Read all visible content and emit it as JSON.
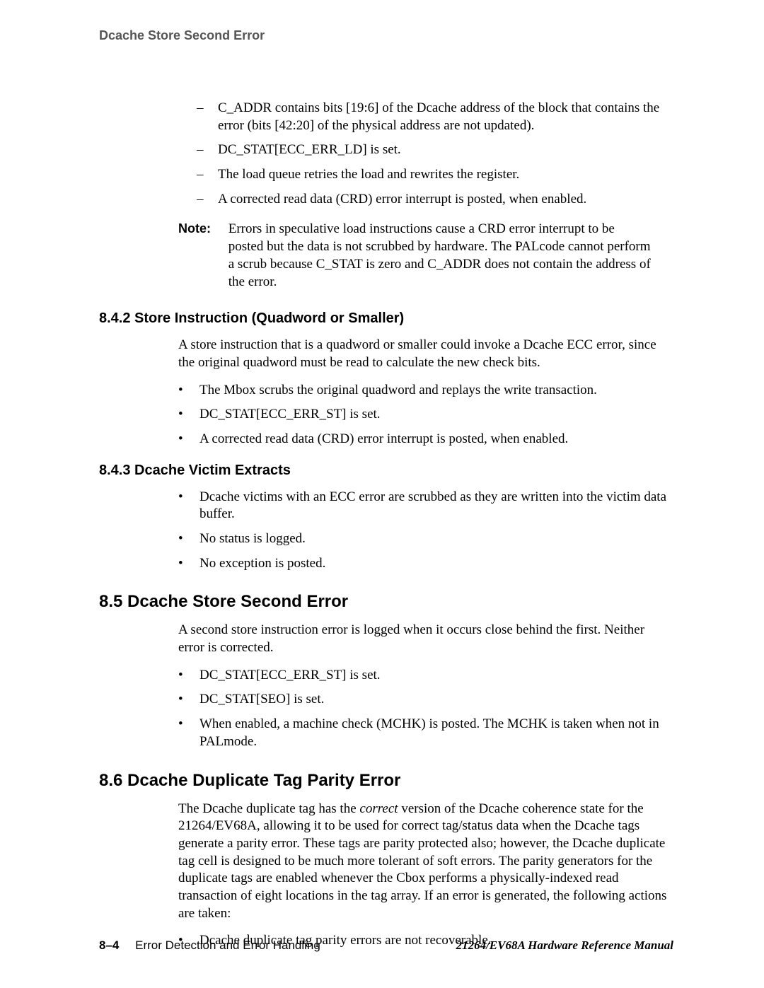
{
  "runningHead": "Dcache Store Second Error",
  "dashList": [
    "C_ADDR contains bits [19:6] of the Dcache address of the block that contains the error  (bits [42:20] of the physical address are not updated).",
    "DC_STAT[ECC_ERR_LD] is set.",
    "The load queue retries the load and rewrites the register.",
    "A corrected read data (CRD) error interrupt is posted, when enabled."
  ],
  "note": {
    "label": "Note:",
    "body": "Errors in speculative load instructions cause a CRD error interrupt to be posted but the data is not scrubbed by hardware. The PALcode cannot perform a scrub because C_STAT is zero and C_ADDR does not contain the address of the error."
  },
  "s842": {
    "heading": "8.4.2  Store Instruction (Quadword or Smaller)",
    "para": "A store instruction that is a quadword or smaller could invoke a Dcache ECC error, since the original quadword must be read to calculate the new check bits.",
    "bullets": [
      "The Mbox scrubs the original quadword and replays the write transaction.",
      "DC_STAT[ECC_ERR_ST] is set.",
      "A corrected read data (CRD) error interrupt is posted, when enabled."
    ]
  },
  "s843": {
    "heading": "8.4.3  Dcache Victim Extracts",
    "bullets": [
      "Dcache victims with an ECC error are scrubbed as they are written into the victim data buffer.",
      "No status is logged.",
      "No exception is posted."
    ]
  },
  "s85": {
    "heading": "8.5  Dcache Store Second Error",
    "para": "A second store instruction error is logged when it occurs close behind the first. Neither error is corrected.",
    "bullets": [
      "DC_STAT[ECC_ERR_ST] is set.",
      "DC_STAT[SEO] is set.",
      "When enabled, a machine check (MCHK) is posted. The MCHK is taken when not in PALmode."
    ]
  },
  "s86": {
    "heading": "8.6  Dcache Duplicate Tag Parity Error",
    "para_before": "The Dcache duplicate tag has the ",
    "para_em": "correct",
    "para_after": " version of the Dcache coherence state for the 21264/EV68A, allowing it to be used for correct tag/status data when the Dcache tags generate a parity error. These tags are parity protected also; however, the Dcache duplicate tag cell is designed to be much more tolerant of soft errors. The parity generators for the duplicate tags are enabled whenever the Cbox performs a physically-indexed read transaction of eight locations in the tag array. If an error is generated, the following actions are taken:",
    "bullets": [
      "Dcache duplicate tag parity errors are not recoverable."
    ]
  },
  "footer": {
    "page": "8–4",
    "chapter": "Error Detection and Error Handling",
    "manual": "21264/EV68A Hardware Reference Manual"
  }
}
